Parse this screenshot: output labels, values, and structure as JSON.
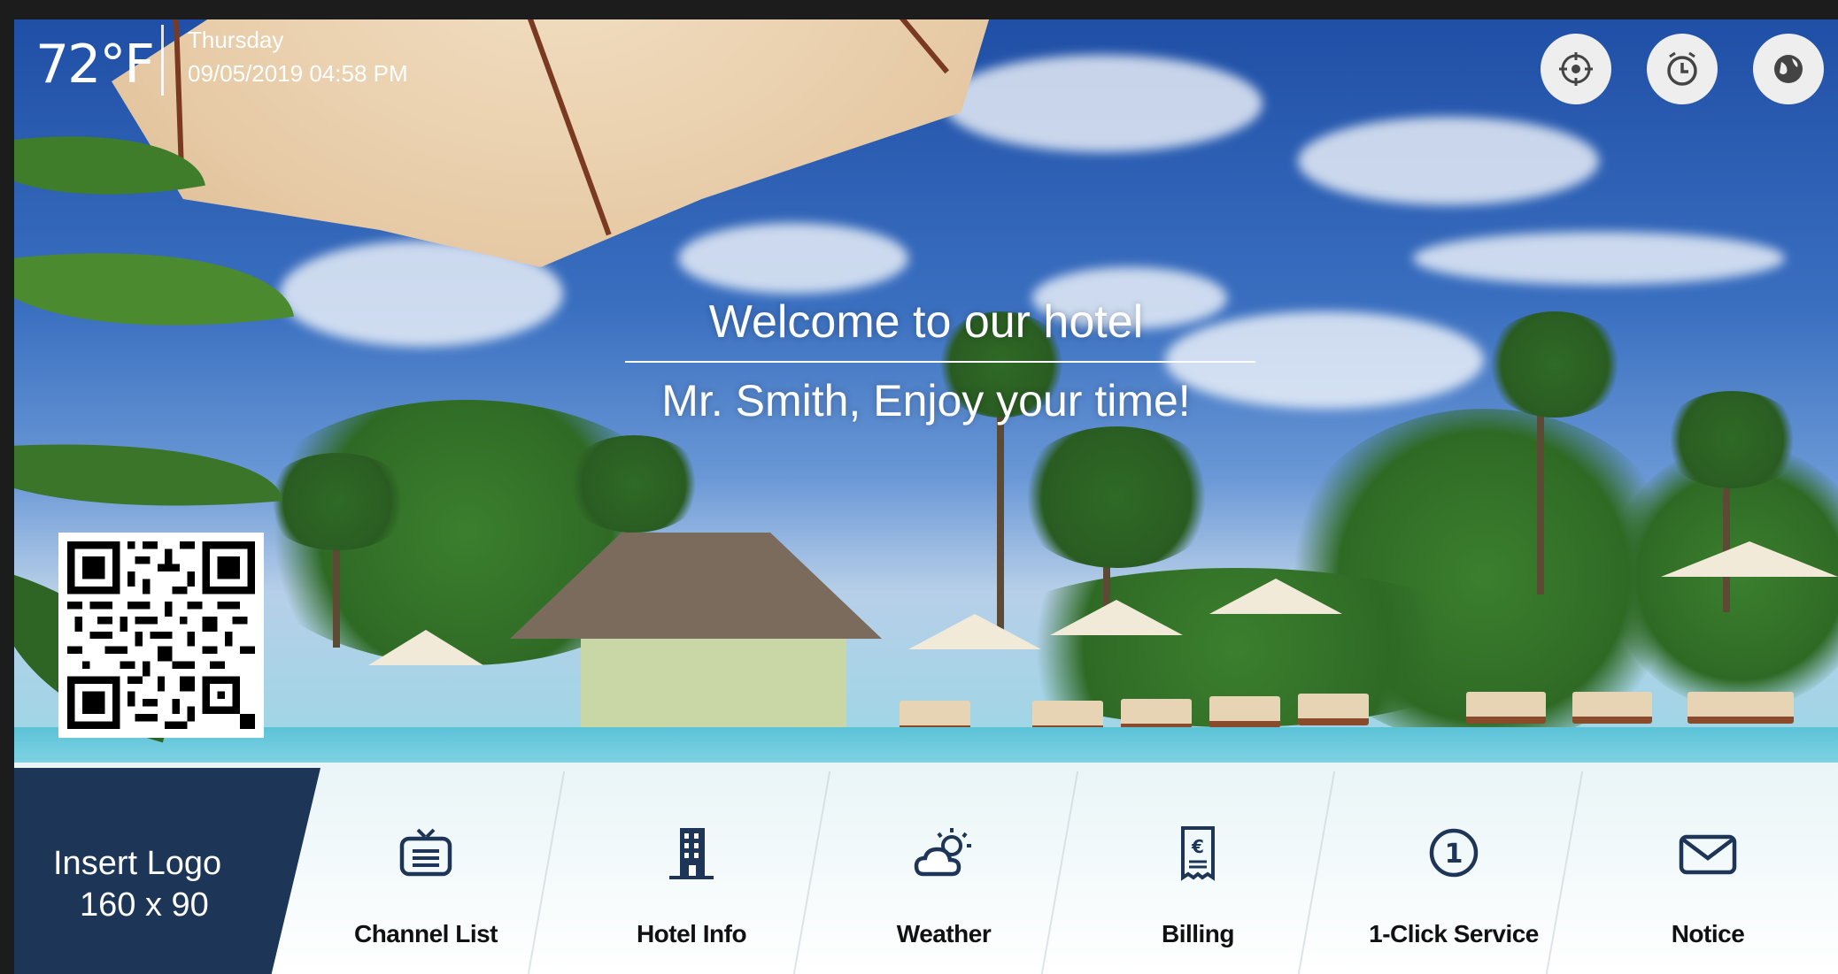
{
  "status": {
    "temperature": "72°F",
    "day": "Thursday",
    "datetime": "09/05/2019 04:58 PM"
  },
  "top_buttons": [
    {
      "icon": "target-icon"
    },
    {
      "icon": "clock-icon"
    },
    {
      "icon": "globe-icon"
    }
  ],
  "welcome": {
    "title": "Welcome to our hotel",
    "subtitle": "Mr. Smith, Enjoy your time!"
  },
  "logo": {
    "line1": "Insert Logo",
    "line2": "160 x 90"
  },
  "menu": [
    {
      "label": "Channel List",
      "icon": "tv-icon"
    },
    {
      "label": "Hotel Info",
      "icon": "building-icon"
    },
    {
      "label": "Weather",
      "icon": "weather-icon"
    },
    {
      "label": "Billing",
      "icon": "receipt-icon"
    },
    {
      "label": "1-Click Service",
      "icon": "one-click-icon"
    },
    {
      "label": "Notice",
      "icon": "envelope-icon"
    }
  ],
  "colors": {
    "logo_panel": "#1d3557",
    "menu_text": "#111111",
    "sky": "#3a6fc0"
  }
}
